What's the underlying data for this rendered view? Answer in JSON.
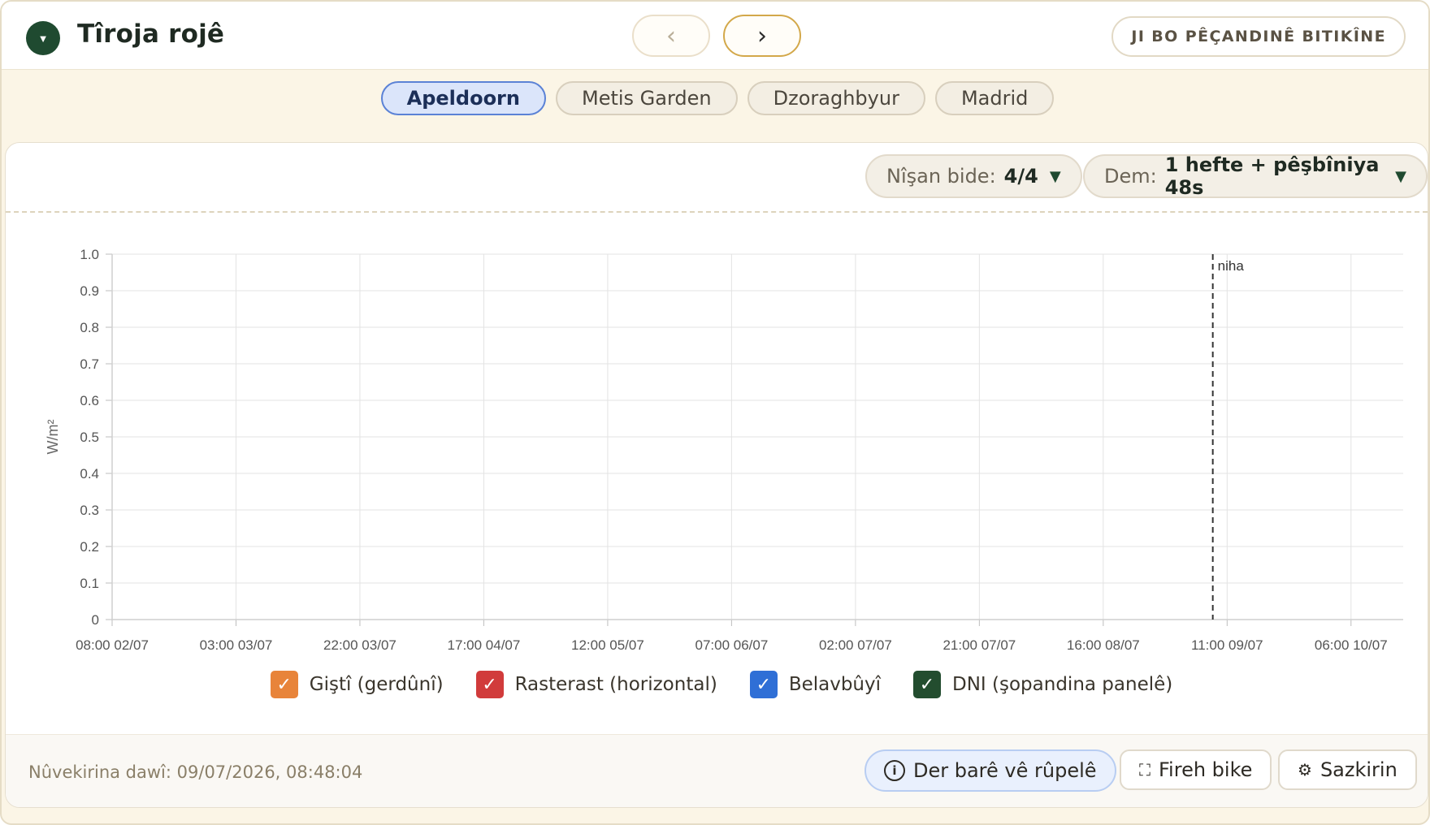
{
  "header": {
    "title": "Tîroja rojê",
    "collapse_glyph": "▼",
    "prev_glyph": "‹",
    "next_glyph": "›",
    "report_button": "JI BO PÊÇANDINÊ BITIKÎNE"
  },
  "tabs": [
    {
      "label": "Apeldoorn",
      "active": true
    },
    {
      "label": "Metis Garden",
      "active": false
    },
    {
      "label": "Dzoraghbyur",
      "active": false
    },
    {
      "label": "Madrid",
      "active": false
    }
  ],
  "controls": {
    "target_label": "Nîşan bide:",
    "target_value": "4/4",
    "period_label": "Dem:",
    "period_value": "1 hefte + pêşbîniya 48s",
    "caret": "▼"
  },
  "chart_data": {
    "type": "line",
    "title": "",
    "xlabel": "",
    "ylabel": "W/m²",
    "ylim": [
      0,
      1.0
    ],
    "yticks": [
      "0",
      "0.1",
      "0.2",
      "0.3",
      "0.4",
      "0.5",
      "0.6",
      "0.7",
      "0.8",
      "0.9",
      "1.0"
    ],
    "x_range": [
      "2026-07-02T08:00",
      "2026-07-10T14:00"
    ],
    "xticks": [
      {
        "t": "2026-07-02T08:00",
        "label": "08:00 02/07"
      },
      {
        "t": "2026-07-03T03:00",
        "label": "03:00 03/07"
      },
      {
        "t": "2026-07-03T22:00",
        "label": "22:00 03/07"
      },
      {
        "t": "2026-07-04T17:00",
        "label": "17:00 04/07"
      },
      {
        "t": "2026-07-05T12:00",
        "label": "12:00 05/07"
      },
      {
        "t": "2026-07-06T07:00",
        "label": "07:00 06/07"
      },
      {
        "t": "2026-07-07T02:00",
        "label": "02:00 07/07"
      },
      {
        "t": "2026-07-07T21:00",
        "label": "21:00 07/07"
      },
      {
        "t": "2026-07-08T16:00",
        "label": "16:00 08/07"
      },
      {
        "t": "2026-07-09T11:00",
        "label": "11:00 09/07"
      },
      {
        "t": "2026-07-10T06:00",
        "label": "06:00 10/07"
      }
    ],
    "now_marker": {
      "t": "2026-07-09T08:48",
      "label": "niha"
    },
    "grid": true,
    "legend_position": "bottom",
    "series": [
      {
        "name": "Giştî (gerdûnî)",
        "color": "#e8843a",
        "checked": true,
        "values": []
      },
      {
        "name": "Rasterast (horizontal)",
        "color": "#d13b3b",
        "checked": true,
        "values": []
      },
      {
        "name": "Belavbûyî",
        "color": "#2f6fd6",
        "checked": true,
        "values": []
      },
      {
        "name": "DNI (şopandina panelê)",
        "color": "#234d2f",
        "checked": true,
        "values": []
      }
    ]
  },
  "legend_check_glyph": "✓",
  "footer": {
    "updated": "Nûvekirina dawî: 09/07/2026, 08:48:04",
    "info_icon": "i",
    "info_button": "Der barê vê rûpelê",
    "expand_icon": "⛶",
    "expand_button": "Fireh bike",
    "settings_icon": "⚙",
    "settings_button": "Sazkirin"
  }
}
